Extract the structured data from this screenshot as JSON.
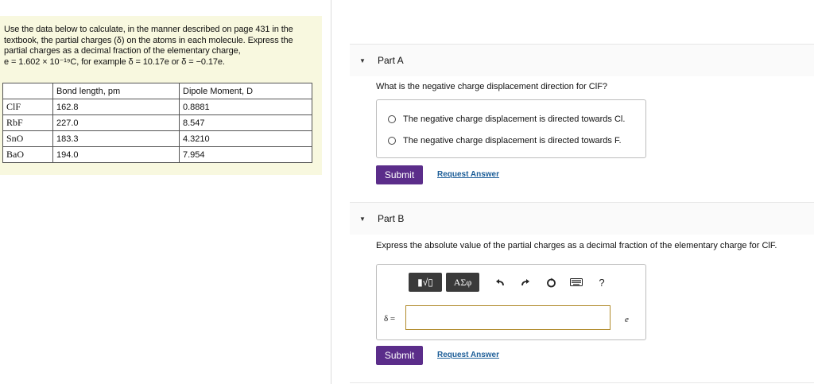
{
  "intro": {
    "line1": "Use the data below to calculate, in the manner described on page 431 in the",
    "line2": "textbook, the partial charges (δ) on the atoms in each molecule. Express the",
    "line3": "partial charges as a decimal fraction of the elementary charge,",
    "line4": "e = 1.602 × 10⁻¹⁹C, for example δ = 10.17e or δ = −0.17e."
  },
  "table": {
    "headers": [
      "",
      "Bond length, pm",
      "Dipole Moment, D"
    ],
    "rows": [
      [
        "ClF",
        "162.8",
        "0.8881"
      ],
      [
        "RbF",
        "227.0",
        "8.547"
      ],
      [
        "SnO",
        "183.3",
        "4.3210"
      ],
      [
        "BaO",
        "194.0",
        "7.954"
      ]
    ]
  },
  "partA": {
    "title": "Part A",
    "question": "What is the negative charge displacement direction for ClF?",
    "options": [
      "The negative charge displacement is directed towards Cl.",
      "The negative charge displacement is directed towards F."
    ],
    "submit": "Submit",
    "request": "Request Answer"
  },
  "partB": {
    "title": "Part B",
    "question": "Express the absolute value of the partial charges as a decimal fraction of the elementary charge for ClF.",
    "toolbar": {
      "template_label": "▮√▯",
      "greek_label": "ΑΣφ",
      "help_label": "?"
    },
    "icons": [
      "undo-icon",
      "redo-icon",
      "reset-icon",
      "keyboard-icon",
      "help-icon"
    ],
    "delta_label": "δ =",
    "input_value": "",
    "unit": "e",
    "submit": "Submit",
    "request": "Request Answer"
  },
  "colors": {
    "panel_bg": "#f8f8df",
    "submit_bg": "#5b2d8a",
    "link": "#1d5e98",
    "input_border": "#b08a2a"
  }
}
